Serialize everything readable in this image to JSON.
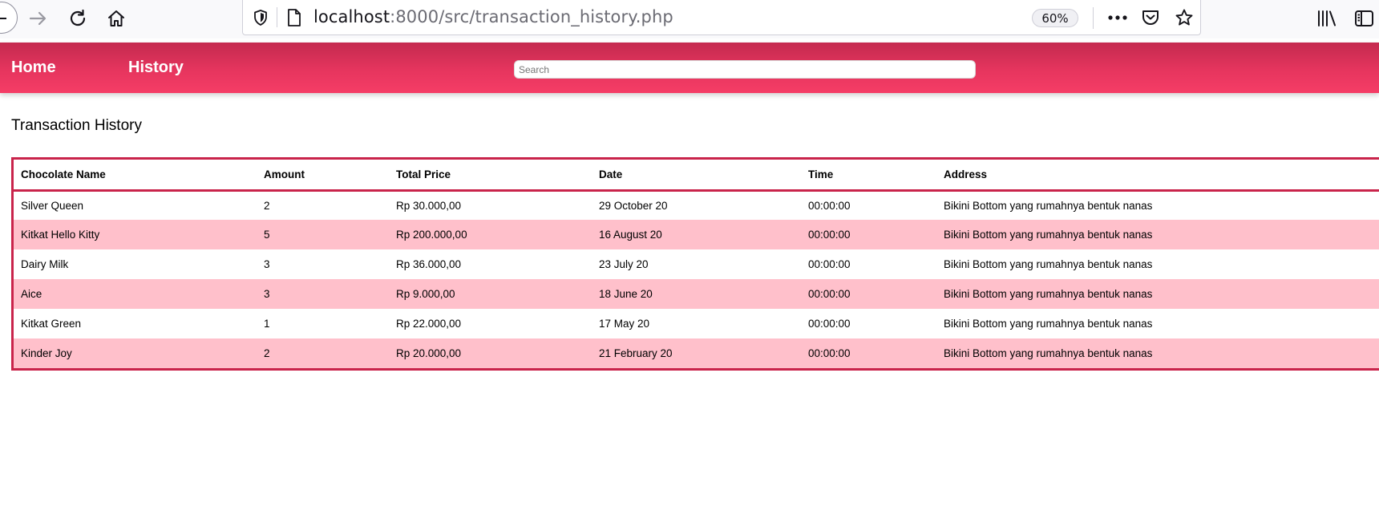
{
  "browser": {
    "url_host": "localhost",
    "url_path": ":8000/src/transaction_history.php",
    "zoom": "60%"
  },
  "header": {
    "nav": [
      {
        "label": "Home"
      },
      {
        "label": "History"
      }
    ],
    "search_placeholder": "Search"
  },
  "page": {
    "title": "Transaction History"
  },
  "table": {
    "columns": [
      "Chocolate Name",
      "Amount",
      "Total Price",
      "Date",
      "Time",
      "Address"
    ],
    "rows": [
      [
        "Silver Queen",
        "2",
        "Rp 30.000,00",
        "29 October 20",
        "00:00:00",
        "Bikini Bottom yang rumahnya bentuk nanas"
      ],
      [
        "Kitkat Hello Kitty",
        "5",
        "Rp 200.000,00",
        "16 August 20",
        "00:00:00",
        "Bikini Bottom yang rumahnya bentuk nanas"
      ],
      [
        "Dairy Milk",
        "3",
        "Rp 36.000,00",
        "23 July 20",
        "00:00:00",
        "Bikini Bottom yang rumahnya bentuk nanas"
      ],
      [
        "Aice",
        "3",
        "Rp 9.000,00",
        "18 June 20",
        "00:00:00",
        "Bikini Bottom yang rumahnya bentuk nanas"
      ],
      [
        "Kitkat Green",
        "1",
        "Rp 22.000,00",
        "17 May 20",
        "00:00:00",
        "Bikini Bottom yang rumahnya bentuk nanas"
      ],
      [
        "Kinder Joy",
        "2",
        "Rp 20.000,00",
        "21 February 20",
        "00:00:00",
        "Bikini Bottom yang rumahnya bentuk nanas"
      ]
    ]
  },
  "colors": {
    "header_top": "#c42a4f",
    "header_bottom": "#f53d66",
    "table_border": "#c9244b",
    "row_alt": "#ffc0cb"
  },
  "icons": [
    "back-icon",
    "forward-icon",
    "reload-icon",
    "home-icon",
    "shield-icon",
    "page-icon",
    "more-icon",
    "pocket-icon",
    "star-icon",
    "library-icon",
    "sidebar-icon"
  ]
}
